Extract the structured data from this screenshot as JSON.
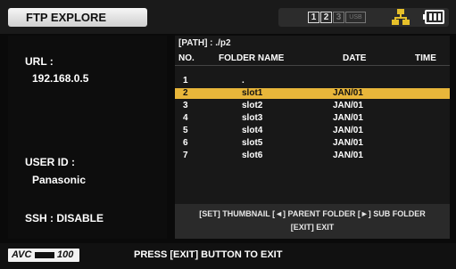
{
  "header": {
    "title": "FTP EXPLORE",
    "slots": [
      "1",
      "2",
      "3"
    ],
    "usb_label": "USB"
  },
  "left": {
    "url_label": "URL :",
    "url_value": "192.168.0.5",
    "user_label": "USER ID :",
    "user_value": "Panasonic",
    "ssh": "SSH : DISABLE"
  },
  "browser": {
    "path": "[PATH] : ./p2",
    "columns": [
      "NO.",
      "FOLDER NAME",
      "DATE",
      "TIME"
    ],
    "rows": [
      {
        "no": "1",
        "name": ".",
        "date": "",
        "time": ""
      },
      {
        "no": "2",
        "name": "slot1",
        "date": "JAN/01",
        "time": ""
      },
      {
        "no": "3",
        "name": "slot2",
        "date": "JAN/01",
        "time": ""
      },
      {
        "no": "4",
        "name": "slot3",
        "date": "JAN/01",
        "time": ""
      },
      {
        "no": "5",
        "name": "slot4",
        "date": "JAN/01",
        "time": ""
      },
      {
        "no": "6",
        "name": "slot5",
        "date": "JAN/01",
        "time": ""
      },
      {
        "no": "7",
        "name": "slot6",
        "date": "JAN/01",
        "time": ""
      }
    ],
    "selected_row": 1,
    "help_line1": "[SET] THUMBNAIL  [◄] PARENT FOLDER  [►] SUB FOLDER",
    "help_line2": "[EXIT] EXIT"
  },
  "footer": {
    "logo_text": "AVC",
    "logo_sub": "100",
    "message": "PRESS [EXIT] BUTTON TO EXIT"
  },
  "colors": {
    "selection": "#e8b63a",
    "network_icon": "#e6c02a"
  },
  "icons": [
    "battery-icon",
    "network-icon",
    "usb-icon"
  ]
}
